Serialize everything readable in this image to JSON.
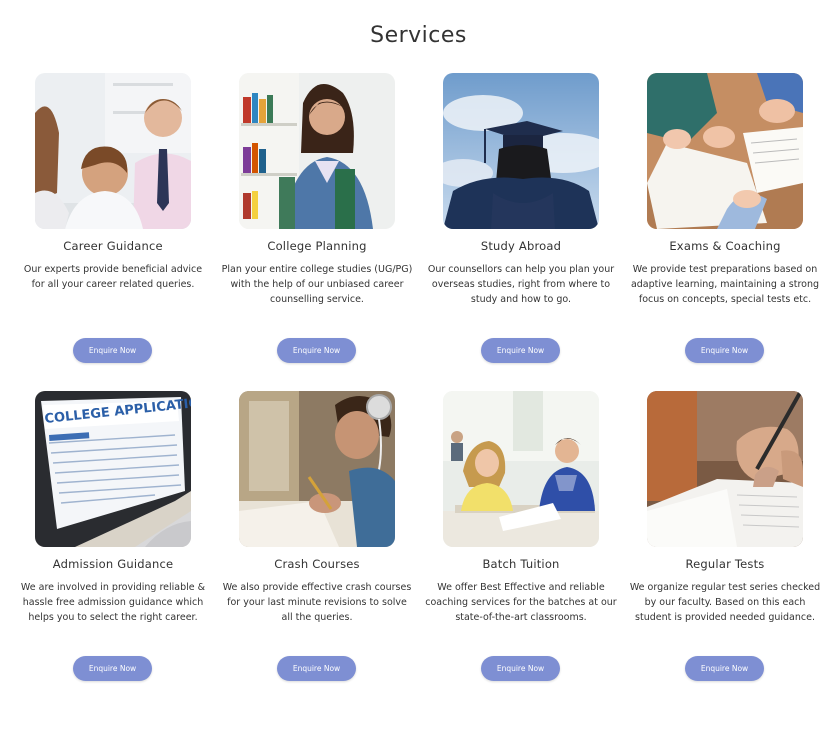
{
  "section": {
    "title": "Services"
  },
  "accent_color": "#7e8fd3",
  "cards": [
    {
      "title": "Career Guidance",
      "description": "Our experts provide beneficial advice for all your career related queries.",
      "button": "Enquire Now",
      "image": "counsellor-meeting-photo"
    },
    {
      "title": "College Planning",
      "description": "Plan your entire college studies (UG/PG) with the help of our unbiased career counselling service.",
      "button": "Enquire Now",
      "image": "student-with-books-photo"
    },
    {
      "title": "Study Abroad",
      "description": "Our counsellors can help you plan your overseas studies, right from where to study and how to go.",
      "button": "Enquire Now",
      "image": "graduate-cap-sky-photo"
    },
    {
      "title": "Exams & Coaching",
      "description": "We provide test preparations based on adaptive learning, maintaining a strong focus on concepts, special tests etc.",
      "button": "Enquire Now",
      "image": "students-writing-photo"
    },
    {
      "title": "Admission Guidance",
      "description": "We are involved in providing reliable & hassle free admission guidance which helps you to select the right career.",
      "button": "Enquire Now",
      "image": "college-application-laptop-photo",
      "image_text": "COLLEGE APPLICATION"
    },
    {
      "title": "Crash Courses",
      "description": "We also provide effective crash courses for your last minute revisions to solve all the queries.",
      "button": "Enquire Now",
      "image": "boy-studying-headphones-photo"
    },
    {
      "title": "Batch Tuition",
      "description": "We offer Best Effective and reliable coaching services for the batches at our state-of-the-art classrooms.",
      "button": "Enquire Now",
      "image": "classroom-students-photo"
    },
    {
      "title": "Regular Tests",
      "description": "We organize regular test series checked by our faculty. Based on this each student is provided needed guidance.",
      "button": "Enquire Now",
      "image": "hand-writing-exam-photo"
    }
  ]
}
